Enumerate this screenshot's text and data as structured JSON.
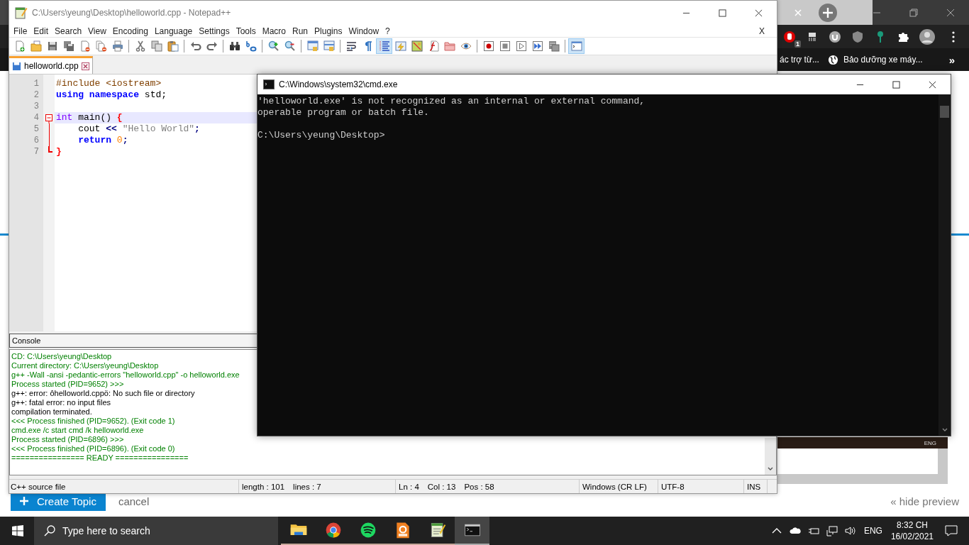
{
  "browser": {
    "extension_badge": "1",
    "bookmarks": [
      {
        "label": "ác trợ từ...",
        "kind": "text"
      },
      {
        "label": "Bảo dưỡng xe máy...",
        "kind": "globe"
      }
    ],
    "bookmarks_more": "»",
    "page": {
      "preview_tray_text": "ENG",
      "create_button": "Create Topic",
      "cancel": "cancel",
      "hide_preview": "« hide preview"
    }
  },
  "notepad": {
    "title": "C:\\Users\\yeung\\Desktop\\helloworld.cpp - Notepad++",
    "menu": [
      "File",
      "Edit",
      "Search",
      "View",
      "Encoding",
      "Language",
      "Settings",
      "Tools",
      "Macro",
      "Run",
      "Plugins",
      "Window",
      "?"
    ],
    "menu_close": "X",
    "toolbar": [
      {
        "kind": "new",
        "selected": false
      },
      {
        "kind": "open",
        "selected": false
      },
      {
        "kind": "save",
        "selected": false
      },
      {
        "kind": "save-all",
        "selected": false
      },
      {
        "kind": "close",
        "selected": false
      },
      {
        "kind": "close-all",
        "selected": false
      },
      {
        "kind": "print",
        "selected": false
      },
      {
        "kind": "separator"
      },
      {
        "kind": "cut",
        "selected": false
      },
      {
        "kind": "copy",
        "selected": false
      },
      {
        "kind": "paste",
        "selected": false
      },
      {
        "kind": "separator"
      },
      {
        "kind": "undo",
        "selected": false
      },
      {
        "kind": "redo",
        "selected": false
      },
      {
        "kind": "separator"
      },
      {
        "kind": "find",
        "selected": false
      },
      {
        "kind": "replace",
        "selected": false
      },
      {
        "kind": "separator"
      },
      {
        "kind": "zoom-in",
        "selected": false
      },
      {
        "kind": "zoom-out",
        "selected": false
      },
      {
        "kind": "separator"
      },
      {
        "kind": "sync-v",
        "selected": false
      },
      {
        "kind": "sync-h",
        "selected": false
      },
      {
        "kind": "separator"
      },
      {
        "kind": "wrap",
        "selected": false
      },
      {
        "kind": "all-chars",
        "selected": false
      },
      {
        "kind": "indent-guide",
        "selected": true
      },
      {
        "kind": "udl",
        "selected": false
      },
      {
        "kind": "doc-map",
        "selected": false
      },
      {
        "kind": "function-list",
        "selected": false
      },
      {
        "kind": "folder",
        "selected": false
      },
      {
        "kind": "monitor",
        "selected": false
      },
      {
        "kind": "separator"
      },
      {
        "kind": "record",
        "selected": false
      },
      {
        "kind": "stop",
        "selected": false
      },
      {
        "kind": "play",
        "selected": false
      },
      {
        "kind": "play-multi",
        "selected": false
      },
      {
        "kind": "save-macro",
        "selected": false
      },
      {
        "kind": "separator"
      },
      {
        "kind": "console",
        "selected": true
      }
    ],
    "tabs": [
      {
        "label": "helloworld.cpp",
        "selected": true
      }
    ],
    "code": [
      {
        "number": "1",
        "current": false,
        "kind": "plain",
        "tokens": [
          {
            "text": "#include <iostream>",
            "kind": "preprocessor"
          }
        ]
      },
      {
        "number": "2",
        "current": false,
        "kind": "plain",
        "tokens": [
          {
            "text": "using",
            "kind": "keyword"
          },
          {
            "text": " namespace",
            "kind": "keyword"
          },
          {
            "text": " std;",
            "kind": "plain"
          }
        ]
      },
      {
        "number": "3",
        "current": false,
        "kind": "plain"
      },
      {
        "number": "4",
        "current": true,
        "kind": "fold-start",
        "tokens": [
          {
            "text": "int",
            "kind": "type"
          },
          {
            "text": " main() ",
            "kind": "plain"
          },
          {
            "text": "{",
            "kind": "brace"
          }
        ]
      },
      {
        "number": "5",
        "current": false,
        "kind": "fold-mid",
        "tokens": [
          {
            "text": "    cout ",
            "kind": "plain"
          },
          {
            "text": "<<",
            "kind": "operator"
          },
          {
            "text": " \"Hello World\"",
            "kind": "string"
          },
          {
            "text": ";",
            "kind": "operator"
          }
        ]
      },
      {
        "number": "6",
        "current": false,
        "kind": "fold-mid",
        "tokens": [
          {
            "text": "    return",
            "kind": "keyword"
          },
          {
            "text": " 0",
            "kind": "number"
          },
          {
            "text": ";",
            "kind": "operator"
          }
        ]
      },
      {
        "number": "7",
        "current": false,
        "kind": "fold-end",
        "tokens": [
          {
            "text": "}",
            "kind": "brace"
          }
        ]
      }
    ],
    "console": {
      "title": "Console",
      "lines": [
        {
          "text": "CD: C:\\Users\\yeung\\Desktop",
          "kind": "info"
        },
        {
          "text": "Current directory: C:\\Users\\yeung\\Desktop",
          "kind": "info"
        },
        {
          "text": "g++ -Wall -ansi -pedantic-errors \"helloworld.cpp\" -o helloworld.exe",
          "kind": "info"
        },
        {
          "text": "Process started (PID=9652) >>>",
          "kind": "info"
        },
        {
          "text": "g++: error: ôhelloworld.cppö: No such file or directory",
          "kind": "output"
        },
        {
          "text": "g++: fatal error: no input files",
          "kind": "output"
        },
        {
          "text": "compilation terminated.",
          "kind": "output"
        },
        {
          "text": "<<< Process finished (PID=9652). (Exit code 1)",
          "kind": "info"
        },
        {
          "text": "cmd.exe /c start cmd /k helloworld.exe",
          "kind": "info"
        },
        {
          "text": "Process started (PID=6896) >>>",
          "kind": "info"
        },
        {
          "text": "<<< Process finished (PID=6896). (Exit code 0)",
          "kind": "info"
        },
        {
          "text": "================ READY ================",
          "kind": "info"
        }
      ]
    },
    "status_bar": {
      "file_type": "C++ source file",
      "length": "length : 101",
      "lines": "lines : 7",
      "ln": "Ln : 4",
      "col": "Col : 13",
      "pos": "Pos : 58",
      "eol": "Windows (CR LF)",
      "encoding": "UTF-8",
      "mode": "INS"
    }
  },
  "cmd": {
    "title": "C:\\Windows\\system32\\cmd.exe",
    "blocks": [
      {
        "lines": [
          "'helloworld.exe' is not recognized as an internal or external command,",
          "operable program or batch file."
        ]
      },
      {
        "lines": [
          "C:\\Users\\yeung\\Desktop>"
        ]
      }
    ]
  },
  "taskbar": {
    "search_placeholder": "Type here to search",
    "apps": [
      {
        "kind": "folder",
        "selected": false
      },
      {
        "kind": "chrome",
        "selected": false
      },
      {
        "kind": "music",
        "selected": false
      },
      {
        "kind": "pdf",
        "selected": false
      },
      {
        "kind": "notepad",
        "selected": false
      },
      {
        "kind": "terminal",
        "selected": true
      }
    ],
    "language": "ENG",
    "time": "8:32 CH",
    "date": "16/02/2021"
  }
}
